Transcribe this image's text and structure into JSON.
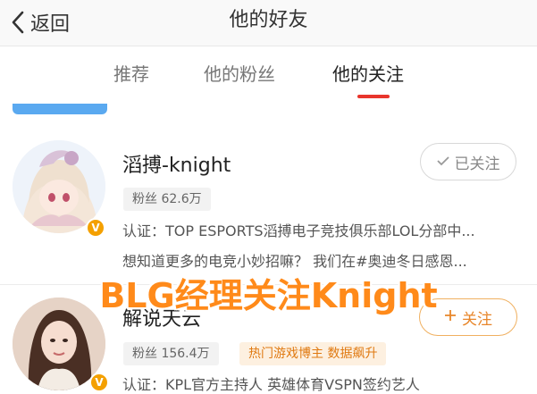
{
  "header": {
    "back_label": "返回",
    "title": "他的好友"
  },
  "tabs": [
    {
      "label": "推荐"
    },
    {
      "label": "他的粉丝"
    },
    {
      "label": "他的关注"
    }
  ],
  "active_tab": "他的关注",
  "accent_color": "#e8352c",
  "users": [
    {
      "name": "滔搏-knight",
      "fans": "粉丝 62.6万",
      "verification": "认证：TOP ESPORTS滔搏电子竞技俱乐部LOL分部中...",
      "bio": "想知道更多的电竞小妙招嘛？ 我们在#奥迪冬日感恩...",
      "follow_status": "已关注",
      "follow_icon": "check-icon"
    },
    {
      "name": "解说天云",
      "fans": "粉丝 156.4万",
      "tag": "热门游戏博主 数据飙升",
      "verification": "认证：KPL官方主持人 英雄体育VSPN签约艺人",
      "follow_status": "关注",
      "follow_icon": "plus-icon"
    }
  ],
  "overlay_caption": "BLG经理关注Knight"
}
